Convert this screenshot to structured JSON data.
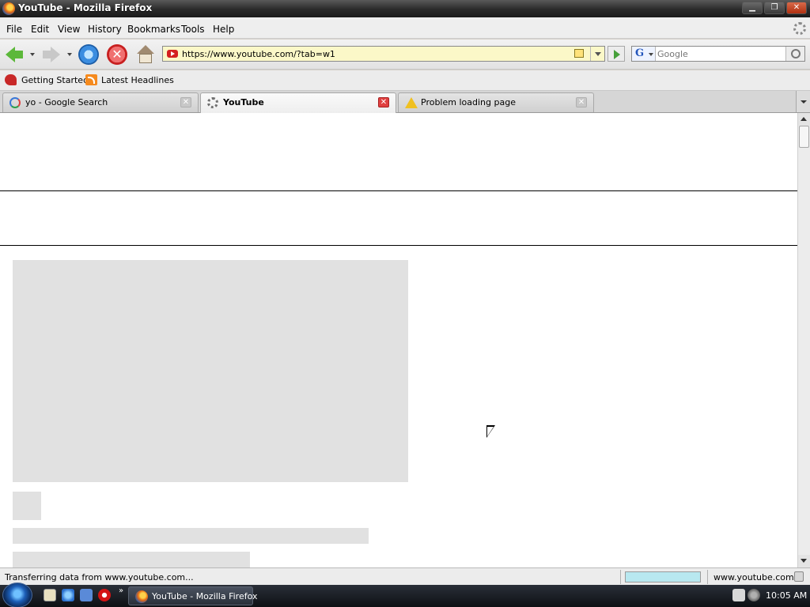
{
  "window": {
    "title": "YouTube - Mozilla Firefox",
    "controls": {
      "minimize": "▁",
      "restore": "❐",
      "close": "✕"
    }
  },
  "menu": [
    "File",
    "Edit",
    "View",
    "History",
    "Bookmarks",
    "Tools",
    "Help"
  ],
  "nav": {
    "url": "https://www.youtube.com/?tab=w1",
    "search_placeholder": "Google",
    "search_engine_letter": "G",
    "stop_glyph": "✕"
  },
  "bookmarks": [
    "Getting Started",
    "Latest Headlines"
  ],
  "tabs": [
    {
      "label": "yo - Google Search",
      "icon": "google-icon",
      "active": false
    },
    {
      "label": "YouTube",
      "icon": "loading-icon",
      "active": true
    },
    {
      "label": "Problem loading page",
      "icon": "warning-icon",
      "active": false
    }
  ],
  "tab_close_glyph": "✕",
  "status": {
    "text": "Transferring data from www.youtube.com...",
    "host": "www.youtube.com"
  },
  "taskbar": {
    "task_label": "YouTube - Mozilla Firefox",
    "chevron": "»",
    "clock": "10:05 AM"
  }
}
